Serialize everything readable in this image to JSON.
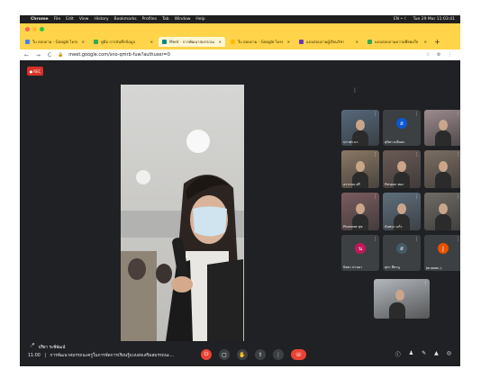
{
  "menubar": {
    "apple": "",
    "app": "Chrome",
    "items": [
      "File",
      "Edit",
      "View",
      "History",
      "Bookmarks",
      "Profiles",
      "Tab",
      "Window",
      "Help"
    ],
    "status": "EN  •  ☾",
    "clock": "Tue 29 Mar  11:03:41"
  },
  "tabs": [
    {
      "label": "ใบ สอบถาม - Google ไดรฟ์",
      "favicon": "#4285f4"
    },
    {
      "label": "คู่มือ การบันทึกข้อมูล",
      "favicon": "#34a853"
    },
    {
      "label": "Meet - การพัฒนาสมรรถนะ",
      "favicon": "#00897b"
    },
    {
      "label": "ใบ สอบถาม - Google ไดรฟ์",
      "favicon": "#fbbc04"
    },
    {
      "label": "แบบสอบถามผู้เรียนวิชา",
      "favicon": "#673ab7"
    },
    {
      "label": "แบบสอบถามความพึงพอใจ",
      "favicon": "#34a853"
    }
  ],
  "address": {
    "nav_icons": "← → C",
    "url": "meet.google.com/sno-qmrb-fuw?authuser=0"
  },
  "rec_label": "REC",
  "tiles": [
    {
      "name": "ปภาพร มา",
      "kind": "video",
      "color": "#56687a"
    },
    {
      "name": "สุนิสา มณีแสง",
      "kind": "avatar",
      "color": "#0b57d0",
      "initial": "ส"
    },
    {
      "name": "",
      "kind": "video",
      "color": "#9c8b8e"
    },
    {
      "name": "อรวรรณ ศรี",
      "kind": "video",
      "color": "#8a7864"
    },
    {
      "name": "Pimpun ทอง",
      "kind": "video",
      "color": "#6a5a55"
    },
    {
      "name": "",
      "kind": "video",
      "color": "#7b6e63"
    },
    {
      "name": "Phannee สุข",
      "kind": "video",
      "color": "#7a5c5f"
    },
    {
      "name": "นันทนา แก้ว",
      "kind": "video",
      "color": "#5f6f7d"
    },
    {
      "name": "",
      "kind": "video",
      "color": "#6e6a64"
    },
    {
      "name": "นิตยา ปานมา",
      "kind": "avatar",
      "color": "#c2185b",
      "initial": "น"
    },
    {
      "name": "สุดา สีหานู",
      "kind": "avatar",
      "color": "#455a64",
      "initial": "ส"
    },
    {
      "name": "Jaruwan J.",
      "kind": "avatar",
      "color": "#e65100",
      "initial": "J"
    },
    {
      "name": "",
      "kind": "video",
      "color": "#b3b8bd"
    }
  ],
  "speaker_name": "ปริยา ระพีพัฒน์",
  "meeting": {
    "time": "11:00",
    "separator": "|",
    "title": "การพัฒนาสมรรถนะครูในการจัดการเรียนรู้แบบส่งเสริมสมรรถนะ..."
  },
  "controls": [
    "mic-off",
    "cam",
    "hand",
    "present",
    "more",
    "end"
  ],
  "right_controls": [
    "info",
    "people",
    "chat",
    "activities",
    "lock"
  ]
}
